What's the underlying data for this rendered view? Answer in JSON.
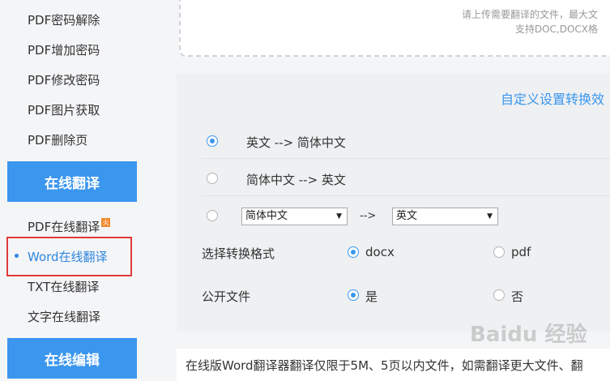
{
  "sidebar": {
    "items_top": [
      "PDF密码解除",
      "PDF增加密码",
      "PDF修改密码",
      "PDF图片获取",
      "PDF删除页"
    ],
    "section_translate": "在线翻译",
    "items_translate": [
      "PDF在线翻译",
      "Word在线翻译",
      "TXT在线翻译",
      "文字在线翻译"
    ],
    "hot_badge": "火",
    "section_edit": "在线编辑"
  },
  "upload": {
    "hint_line1": "请上传需要翻译的文件，最大文",
    "hint_line2": "支持DOC,DOCX格"
  },
  "settings": {
    "title": "自定义设置转换效",
    "option1": "英文 --> 简体中文",
    "option2": "简体中文 --> 英文",
    "source_lang": "简体中文",
    "arrow": "-->",
    "target_lang": "英文",
    "format_label": "选择转换格式",
    "format_docx": "docx",
    "format_pdf": "pdf",
    "public_label": "公开文件",
    "public_yes": "是",
    "public_no": "否"
  },
  "notice": "在线版Word翻译器翻译仅限于5M、5页以内文件，如需翻译更大文件、翻",
  "watermark": "Baidu 经验"
}
